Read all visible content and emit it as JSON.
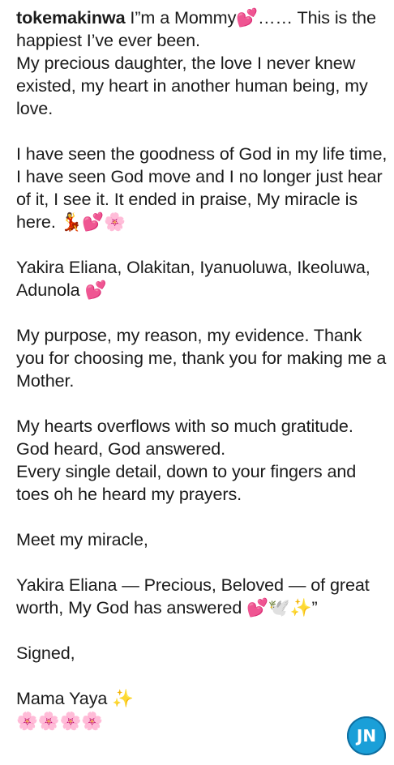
{
  "post": {
    "username": "tokemakinwa",
    "caption_lines": [
      {
        "text": " I”m a Mommy💕…… This is the happiest I’ve ever been."
      },
      {
        "text": "My precious daughter, the love I never knew existed, my heart in another human being, my love."
      },
      {
        "text": ""
      },
      {
        "text": "I have seen the  goodness of God in my life time, I have seen God move and I no longer just hear of  it, I see it. It ended in praise, My miracle is here. 💃💕🌸"
      },
      {
        "text": ""
      },
      {
        "text": "Yakira Eliana, Olakitan, Iyanuoluwa, Ikeoluwa, Adunola 💕"
      },
      {
        "text": ""
      },
      {
        "text": "My purpose, my reason, my evidence. Thank you for choosing me, thank you for making me a Mother."
      },
      {
        "text": ""
      },
      {
        "text": "My hearts overflows with so much gratitude."
      },
      {
        "text": "God heard, God answered."
      },
      {
        "text": "Every single detail, down to your fingers and toes oh he heard my prayers."
      },
      {
        "text": ""
      },
      {
        "text": "Meet my miracle,"
      },
      {
        "text": ""
      },
      {
        "text": "Yakira Eliana — Precious, Beloved — of great worth, My God has answered 💕🕊️✨”"
      },
      {
        "text": ""
      },
      {
        "text": "Signed,"
      },
      {
        "text": ""
      },
      {
        "text": "Mama Yaya ✨"
      },
      {
        "text": "🌸🌸🌸🌸"
      }
    ]
  },
  "watermark": {
    "text": "JN"
  }
}
